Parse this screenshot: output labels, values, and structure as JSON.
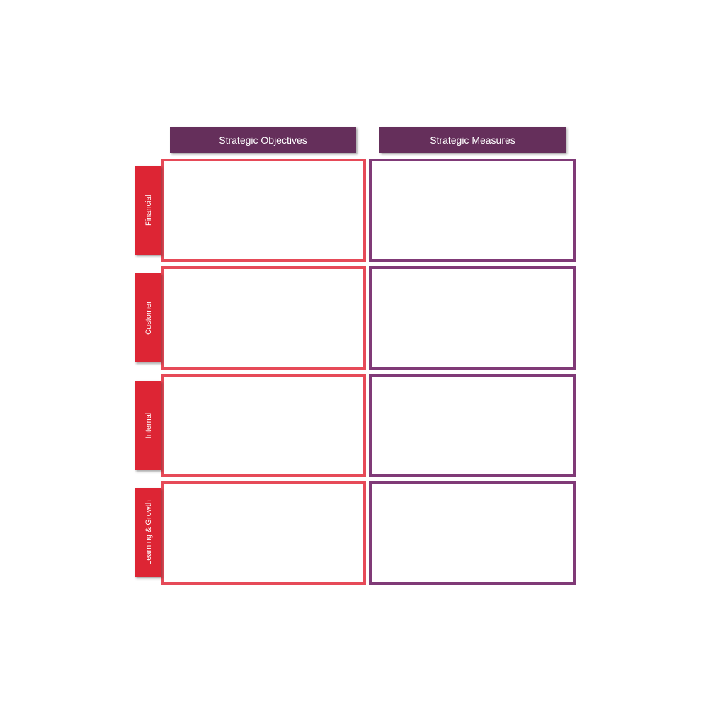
{
  "headers": {
    "objectives": "Strategic Objectives",
    "measures": "Strategic Measures"
  },
  "perspectives": [
    {
      "label": "Financial"
    },
    {
      "label": "Customer"
    },
    {
      "label": "Internal"
    },
    {
      "label": "Learning & Growth"
    }
  ],
  "colors": {
    "header": "#652f5b",
    "tab": "#dd2534",
    "objectives_border": "#e64a58",
    "measures_border": "#803a77"
  }
}
